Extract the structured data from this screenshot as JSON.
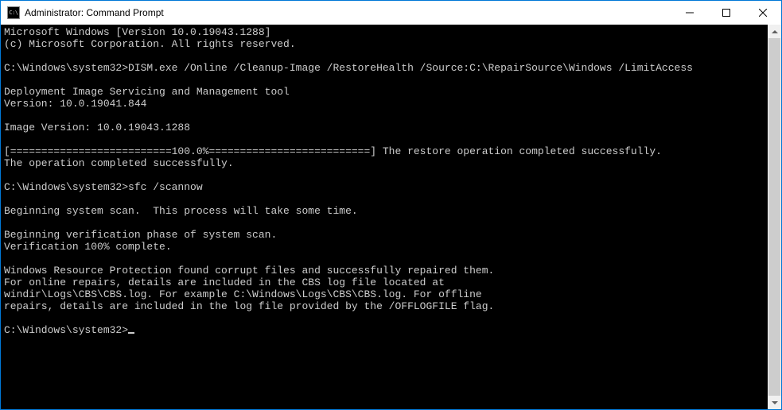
{
  "window": {
    "title": "Administrator: Command Prompt",
    "icon_label": "C:\\"
  },
  "terminal": {
    "prompt": "C:\\Windows\\system32>",
    "lines": {
      "l01": "Microsoft Windows [Version 10.0.19043.1288]",
      "l02": "(c) Microsoft Corporation. All rights reserved.",
      "l03": "",
      "l04": "C:\\Windows\\system32>DISM.exe /Online /Cleanup-Image /RestoreHealth /Source:C:\\RepairSource\\Windows /LimitAccess",
      "l05": "",
      "l06": "Deployment Image Servicing and Management tool",
      "l07": "Version: 10.0.19041.844",
      "l08": "",
      "l09": "Image Version: 10.0.19043.1288",
      "l10": "",
      "l11": "[==========================100.0%==========================] The restore operation completed successfully.",
      "l12": "The operation completed successfully.",
      "l13": "",
      "l14": "C:\\Windows\\system32>sfc /scannow",
      "l15": "",
      "l16": "Beginning system scan.  This process will take some time.",
      "l17": "",
      "l18": "Beginning verification phase of system scan.",
      "l19": "Verification 100% complete.",
      "l20": "",
      "l21": "Windows Resource Protection found corrupt files and successfully repaired them.",
      "l22": "For online repairs, details are included in the CBS log file located at",
      "l23": "windir\\Logs\\CBS\\CBS.log. For example C:\\Windows\\Logs\\CBS\\CBS.log. For offline",
      "l24": "repairs, details are included in the log file provided by the /OFFLOGFILE flag.",
      "l25": "",
      "l26": "C:\\Windows\\system32>"
    }
  }
}
